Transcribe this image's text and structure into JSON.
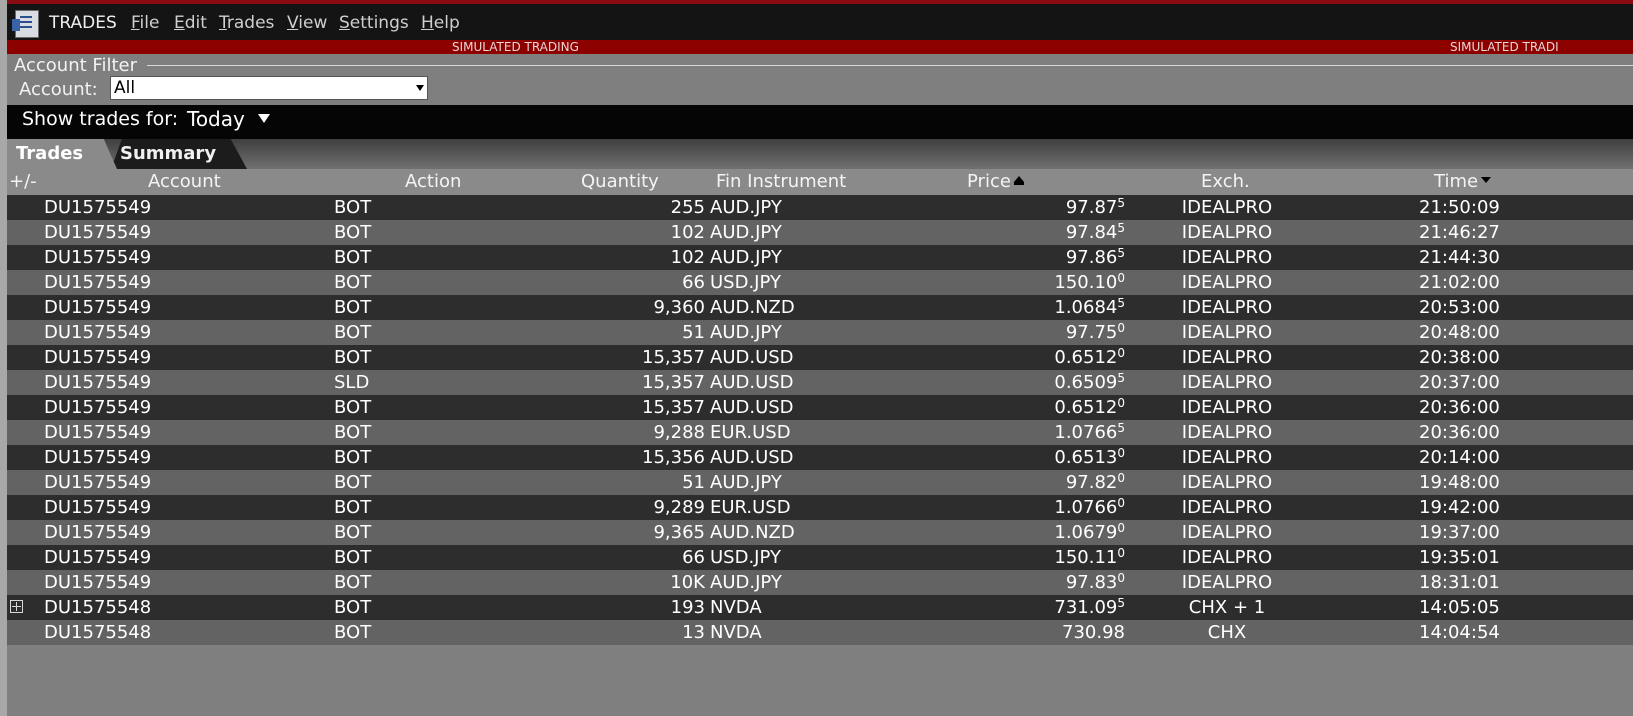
{
  "window": {
    "title": "TRADES",
    "menu": [
      "File",
      "Edit",
      "Trades",
      "View",
      "Settings",
      "Help"
    ],
    "banner_left": "SIMULATED TRADING",
    "banner_right": "SIMULATED TRADI"
  },
  "filter": {
    "title": "Account Filter",
    "account_label": "Account:",
    "account_value": "All"
  },
  "show": {
    "label": "Show trades for:",
    "value": "Today"
  },
  "tabs": [
    "Trades",
    "Summary"
  ],
  "columns": {
    "expand": "+/-",
    "account": "Account",
    "action": "Action",
    "quantity": "Quantity",
    "instrument": "Fin Instrument",
    "price": "Price",
    "exchange": "Exch.",
    "time": "Time"
  },
  "trades": [
    {
      "account": "DU1575549",
      "action": "BOT",
      "quantity": "255",
      "instrument": "AUD.JPY",
      "price": "97.87",
      "price_sup": "5",
      "exchange": "IDEALPRO",
      "time": "21:50:09"
    },
    {
      "account": "DU1575549",
      "action": "BOT",
      "quantity": "102",
      "instrument": "AUD.JPY",
      "price": "97.84",
      "price_sup": "5",
      "exchange": "IDEALPRO",
      "time": "21:46:27"
    },
    {
      "account": "DU1575549",
      "action": "BOT",
      "quantity": "102",
      "instrument": "AUD.JPY",
      "price": "97.86",
      "price_sup": "5",
      "exchange": "IDEALPRO",
      "time": "21:44:30"
    },
    {
      "account": "DU1575549",
      "action": "BOT",
      "quantity": "66",
      "instrument": "USD.JPY",
      "price": "150.10",
      "price_sup": "0",
      "exchange": "IDEALPRO",
      "time": "21:02:00"
    },
    {
      "account": "DU1575549",
      "action": "BOT",
      "quantity": "9,360",
      "instrument": "AUD.NZD",
      "price": "1.0684",
      "price_sup": "5",
      "exchange": "IDEALPRO",
      "time": "20:53:00"
    },
    {
      "account": "DU1575549",
      "action": "BOT",
      "quantity": "51",
      "instrument": "AUD.JPY",
      "price": "97.75",
      "price_sup": "0",
      "exchange": "IDEALPRO",
      "time": "20:48:00"
    },
    {
      "account": "DU1575549",
      "action": "BOT",
      "quantity": "15,357",
      "instrument": "AUD.USD",
      "price": "0.6512",
      "price_sup": "0",
      "exchange": "IDEALPRO",
      "time": "20:38:00"
    },
    {
      "account": "DU1575549",
      "action": "SLD",
      "quantity": "15,357",
      "instrument": "AUD.USD",
      "price": "0.6509",
      "price_sup": "5",
      "exchange": "IDEALPRO",
      "time": "20:37:00"
    },
    {
      "account": "DU1575549",
      "action": "BOT",
      "quantity": "15,357",
      "instrument": "AUD.USD",
      "price": "0.6512",
      "price_sup": "0",
      "exchange": "IDEALPRO",
      "time": "20:36:00"
    },
    {
      "account": "DU1575549",
      "action": "BOT",
      "quantity": "9,288",
      "instrument": "EUR.USD",
      "price": "1.0766",
      "price_sup": "5",
      "exchange": "IDEALPRO",
      "time": "20:36:00"
    },
    {
      "account": "DU1575549",
      "action": "BOT",
      "quantity": "15,356",
      "instrument": "AUD.USD",
      "price": "0.6513",
      "price_sup": "0",
      "exchange": "IDEALPRO",
      "time": "20:14:00"
    },
    {
      "account": "DU1575549",
      "action": "BOT",
      "quantity": "51",
      "instrument": "AUD.JPY",
      "price": "97.82",
      "price_sup": "0",
      "exchange": "IDEALPRO",
      "time": "19:48:00"
    },
    {
      "account": "DU1575549",
      "action": "BOT",
      "quantity": "9,289",
      "instrument": "EUR.USD",
      "price": "1.0766",
      "price_sup": "0",
      "exchange": "IDEALPRO",
      "time": "19:42:00"
    },
    {
      "account": "DU1575549",
      "action": "BOT",
      "quantity": "9,365",
      "instrument": "AUD.NZD",
      "price": "1.0679",
      "price_sup": "0",
      "exchange": "IDEALPRO",
      "time": "19:37:00"
    },
    {
      "account": "DU1575549",
      "action": "BOT",
      "quantity": "66",
      "instrument": "USD.JPY",
      "price": "150.11",
      "price_sup": "0",
      "exchange": "IDEALPRO",
      "time": "19:35:01"
    },
    {
      "account": "DU1575549",
      "action": "BOT",
      "quantity": "10K",
      "instrument": "AUD.JPY",
      "price": "97.83",
      "price_sup": "0",
      "exchange": "IDEALPRO",
      "time": "18:31:01"
    },
    {
      "account": "DU1575548",
      "action": "BOT",
      "quantity": "193",
      "instrument": "NVDA",
      "price": "731.09",
      "price_sup": "5",
      "exchange": "CHX + 1",
      "time": "14:05:05",
      "expandable": true
    },
    {
      "account": "DU1575548",
      "action": "BOT",
      "quantity": "13",
      "instrument": "NVDA",
      "price": "730.98",
      "price_sup": "",
      "exchange": "CHX",
      "time": "14:04:54"
    }
  ]
}
